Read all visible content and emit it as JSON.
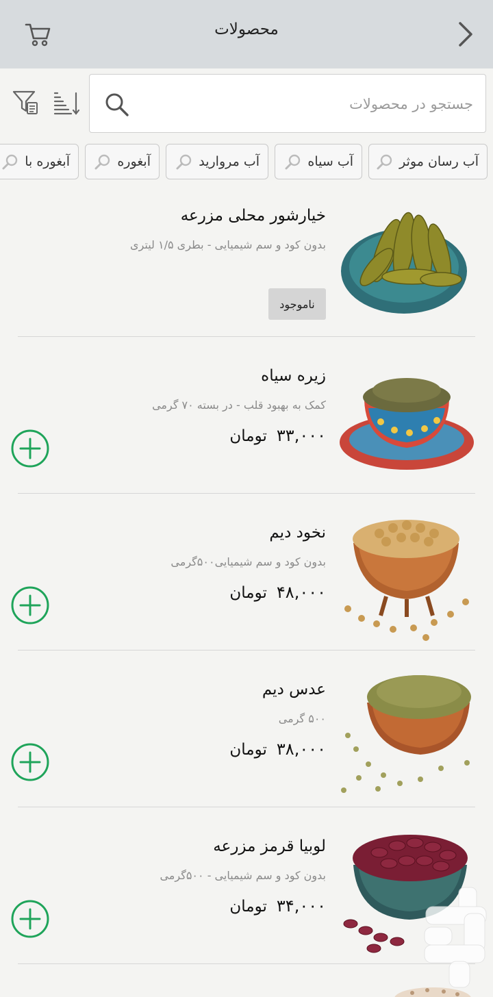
{
  "header": {
    "title": "محصولات"
  },
  "search": {
    "placeholder": "جستجو در محصولات"
  },
  "chips": [
    "آب رسان موثر",
    "آب سیاه",
    "آب مروارید",
    "آبغوره",
    "آبغوره با"
  ],
  "products": [
    {
      "name": "خیارشور محلی مزرعه",
      "desc": "بدون کود و سم شیمیایی - بطری ۱/۵ لیتری",
      "badge": "ناموجود"
    },
    {
      "name": "زیره سیاه",
      "desc": "کمک به بهبود قلب - در بسته ۷۰ گرمی",
      "price": "۳۳,۰۰۰",
      "currency": "تومان"
    },
    {
      "name": "نخود دیم",
      "desc": "بدون کود و سم شیمیایی۵۰۰گرمی",
      "price": "۴۸,۰۰۰",
      "currency": "تومان"
    },
    {
      "name": "عدس دیم",
      "desc": "۵۰۰ گرمی",
      "price": "۳۸,۰۰۰",
      "currency": "تومان"
    },
    {
      "name": "لوبیا قرمز مزرعه",
      "desc": "بدون کود و سم شیمیایی - ۵۰۰گرمی",
      "price": "۳۴,۰۰۰",
      "currency": "تومان"
    }
  ],
  "icons": {
    "back": "chevron-right-icon",
    "cart": "cart-icon",
    "search": "search-icon",
    "sort": "sort-icon",
    "filter": "filter-icon",
    "chip": "search-icon",
    "add": "plus-circle-icon"
  },
  "colors": {
    "appbar": "#d7dbde",
    "accent_green": "#1fa45a",
    "background": "#f4f4f2"
  }
}
